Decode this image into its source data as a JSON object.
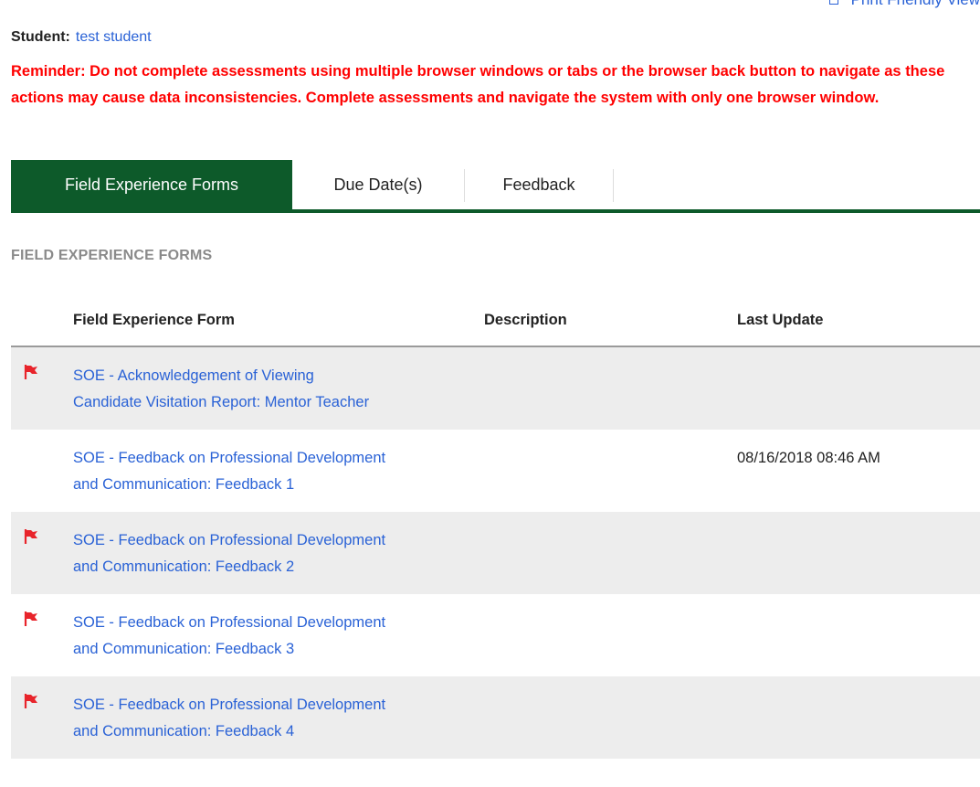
{
  "header": {
    "print_link_label": "Print Friendly View",
    "student_label": "Student:",
    "student_name": "test student",
    "reminder": "Reminder: Do not complete assessments using multiple browser windows or tabs or the browser back button to navigate as these actions may cause data inconsistencies. Complete assessments and navigate the system with only one browser window."
  },
  "tabs": [
    {
      "label": "Field Experience Forms",
      "active": true
    },
    {
      "label": "Due Date(s)",
      "active": false
    },
    {
      "label": "Feedback",
      "active": false
    }
  ],
  "section_title": "FIELD EXPERIENCE FORMS",
  "table": {
    "columns": [
      "Field Experience Form",
      "Description",
      "Last Update"
    ],
    "rows": [
      {
        "flagged": true,
        "form_line1": "SOE - Acknowledgement of Viewing",
        "form_line2": "Candidate Visitation Report: Mentor Teacher",
        "description": "",
        "last_update": ""
      },
      {
        "flagged": false,
        "form_line1": "SOE - Feedback on Professional Development",
        "form_line2": "and Communication: Feedback 1",
        "description": "",
        "last_update": "08/16/2018 08:46 AM"
      },
      {
        "flagged": true,
        "form_line1": "SOE - Feedback on Professional Development",
        "form_line2": "and Communication: Feedback 2",
        "description": "",
        "last_update": ""
      },
      {
        "flagged": true,
        "form_line1": "SOE - Feedback on Professional Development",
        "form_line2": "and Communication: Feedback 3",
        "description": "",
        "last_update": ""
      },
      {
        "flagged": true,
        "form_line1": "SOE - Feedback on Professional Development",
        "form_line2": "and Communication: Feedback 4",
        "description": "",
        "last_update": ""
      }
    ]
  },
  "colors": {
    "tab_active_bg": "#0d5a2a",
    "reminder_text": "#ff0000",
    "link_text": "#2a62d6",
    "flag": "#e8242b",
    "row_shade": "#ededed"
  },
  "icons": {
    "flag": "flag-icon",
    "print": "print-icon"
  }
}
